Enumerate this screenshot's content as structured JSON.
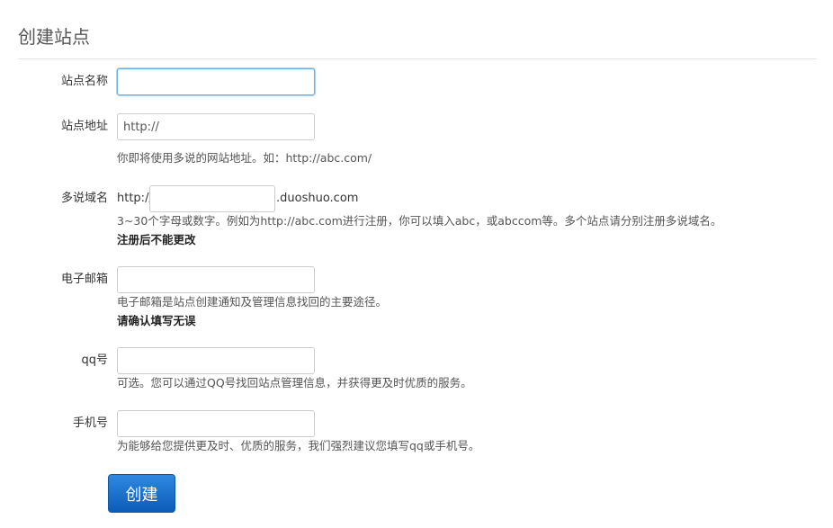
{
  "page": {
    "title": "创建站点"
  },
  "form": {
    "site_name": {
      "label": "站点名称",
      "value": ""
    },
    "site_url": {
      "label": "站点地址",
      "value": "http://",
      "help": "你即将使用多说的网站地址。如：http://abc.com/"
    },
    "duoshuo_domain": {
      "label": "多说域名",
      "prefix": "http://",
      "suffix": ".duoshuo.com",
      "value": "",
      "help": "3~30个字母或数字。例如为http://abc.com进行注册，你可以填入abc，或abccom等。多个站点请分别注册多说域名。",
      "warning": "注册后不能更改"
    },
    "email": {
      "label": "电子邮箱",
      "value": "",
      "help": "电子邮箱是站点创建通知及管理信息找回的主要途径。",
      "warning": "请确认填写无误"
    },
    "qq": {
      "label": "qq号",
      "value": "",
      "help": "可选。您可以通过QQ号找回站点管理信息，并获得更及时优质的服务。"
    },
    "phone": {
      "label": "手机号",
      "value": "",
      "help": "为能够给您提供更及时、优质的服务，我们强烈建议您填写qq或手机号。"
    },
    "submit_label": "创建"
  },
  "colors": {
    "primary": "#1a6fce",
    "focus_border": "#66afe9"
  }
}
